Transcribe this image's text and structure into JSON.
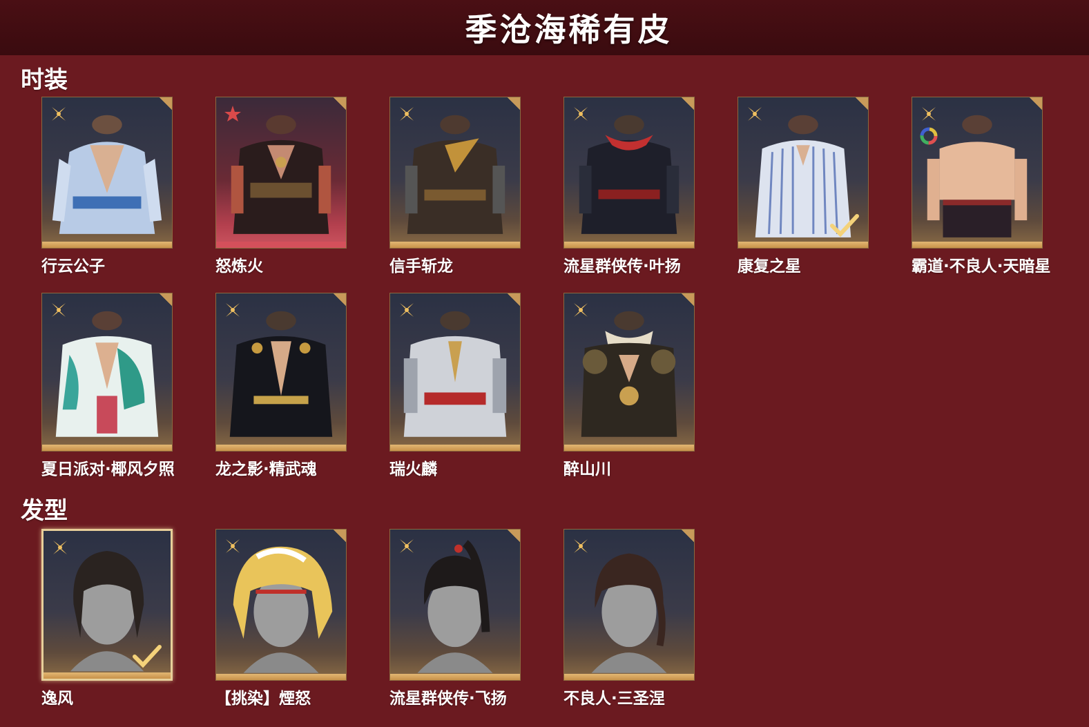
{
  "header": {
    "title": "季沧海稀有皮"
  },
  "sections": {
    "fashion": {
      "title": "时装",
      "row1": [
        {
          "name": "行云公子"
        },
        {
          "name": "怒炼火"
        },
        {
          "name": "信手斩龙"
        },
        {
          "name": "流星群侠传·叶扬"
        },
        {
          "name": "康复之星"
        },
        {
          "name": "霸道·不良人·天暗星"
        }
      ],
      "row2": [
        {
          "name": "夏日派对·椰风夕照"
        },
        {
          "name": "龙之影·精武魂"
        },
        {
          "name": "瑞火麟"
        },
        {
          "name": "醉山川"
        }
      ]
    },
    "hair": {
      "title": "发型",
      "items": [
        {
          "name": "逸风"
        },
        {
          "name": "【挑染】煙怒"
        },
        {
          "name": "流星群侠传·飞扬"
        },
        {
          "name": "不良人·三圣涅"
        }
      ]
    }
  },
  "colors": {
    "background": "#6b1a20",
    "header": "#3a0b0f",
    "gold": "#e2b773",
    "red_rarity": "#d4505b"
  }
}
